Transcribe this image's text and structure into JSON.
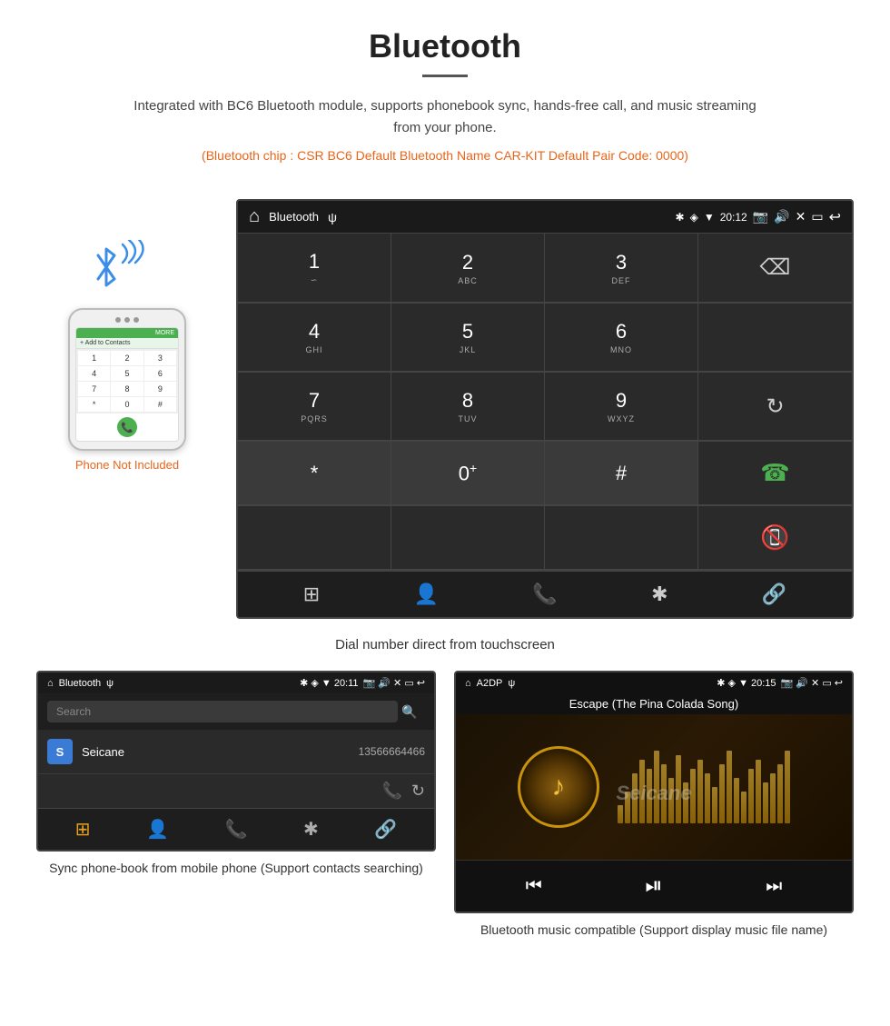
{
  "header": {
    "title": "Bluetooth",
    "description": "Integrated with BC6 Bluetooth module, supports phonebook sync, hands-free call, and music streaming from your phone.",
    "specs": "(Bluetooth chip : CSR BC6    Default Bluetooth Name CAR-KIT    Default Pair Code: 0000)"
  },
  "phone_label": "Phone Not Included",
  "main_screen": {
    "statusbar": {
      "app_name": "Bluetooth",
      "time": "20:12"
    },
    "dialpad": {
      "keys": [
        {
          "number": "1",
          "letters": "∽"
        },
        {
          "number": "2",
          "letters": "ABC"
        },
        {
          "number": "3",
          "letters": "DEF"
        },
        {
          "number": "",
          "letters": "",
          "type": "empty"
        },
        {
          "number": "4",
          "letters": "GHI"
        },
        {
          "number": "5",
          "letters": "JKL"
        },
        {
          "number": "6",
          "letters": "MNO"
        },
        {
          "number": "",
          "letters": "",
          "type": "empty"
        },
        {
          "number": "7",
          "letters": "PQRS"
        },
        {
          "number": "8",
          "letters": "TUV"
        },
        {
          "number": "9",
          "letters": "WXYZ"
        },
        {
          "number": "",
          "letters": "",
          "type": "reload"
        },
        {
          "number": "*",
          "letters": ""
        },
        {
          "number": "0",
          "letters": "+"
        },
        {
          "number": "#",
          "letters": ""
        },
        {
          "number": "",
          "letters": "",
          "type": "call-green"
        },
        {
          "number": "",
          "letters": "",
          "type": "call-red"
        }
      ]
    }
  },
  "main_caption": "Dial number direct from touchscreen",
  "phonebook_screen": {
    "statusbar_left": "⌂  Bluetooth  ψ",
    "statusbar_right": "✱ ◈ ▼ 20:11",
    "search_placeholder": "Search",
    "contact": {
      "initial": "S",
      "name": "Seicane",
      "number": "13566664466"
    }
  },
  "phonebook_caption": "Sync phone-book from mobile phone\n(Support contacts searching)",
  "music_screen": {
    "statusbar_left": "⌂  A2DP  ψ",
    "statusbar_right": "✱ ◈ ▼ 20:15",
    "song_title": "Escape (The Pina Colada Song)",
    "eq_bars": [
      20,
      35,
      55,
      70,
      60,
      80,
      65,
      50,
      75,
      45,
      60,
      70,
      55,
      40,
      65,
      80,
      50,
      35,
      60,
      70,
      45,
      55,
      65,
      80
    ]
  },
  "music_caption": "Bluetooth music compatible\n(Support display music file name)",
  "watermark": "Seicane"
}
